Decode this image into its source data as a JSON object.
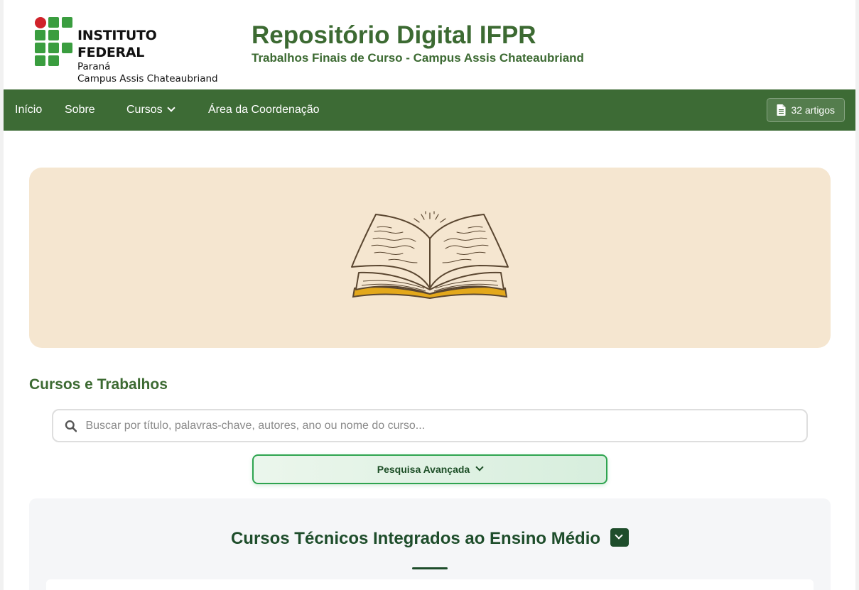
{
  "logo": {
    "line1": "INSTITUTO FEDERAL",
    "line2": "Paraná",
    "line3": "Campus Assis Chateaubriand",
    "colors": {
      "green": "#3a9d3f",
      "red": "#d0222a"
    }
  },
  "header": {
    "title": "Repositório Digital IFPR",
    "subtitle": "Trabalhos Finais de Curso - Campus Assis Chateaubriand"
  },
  "nav": {
    "items": [
      {
        "label": "Início"
      },
      {
        "label": "Sobre"
      },
      {
        "label": "Cursos"
      },
      {
        "label": "Área da Coordenação"
      }
    ],
    "article_count": "32 artigos",
    "color": "#3d6b35"
  },
  "hero": {
    "icon": "open-book-icon",
    "background": "#f5e6d0"
  },
  "section": {
    "title": "Cursos e Trabalhos",
    "search_placeholder": "Buscar por título, palavras-chave, autores, ano ou nome do curso...",
    "advanced_label": "Pesquisa Avançada"
  },
  "panel": {
    "title": "Cursos Técnicos Integrados ao Ensino Médio"
  }
}
